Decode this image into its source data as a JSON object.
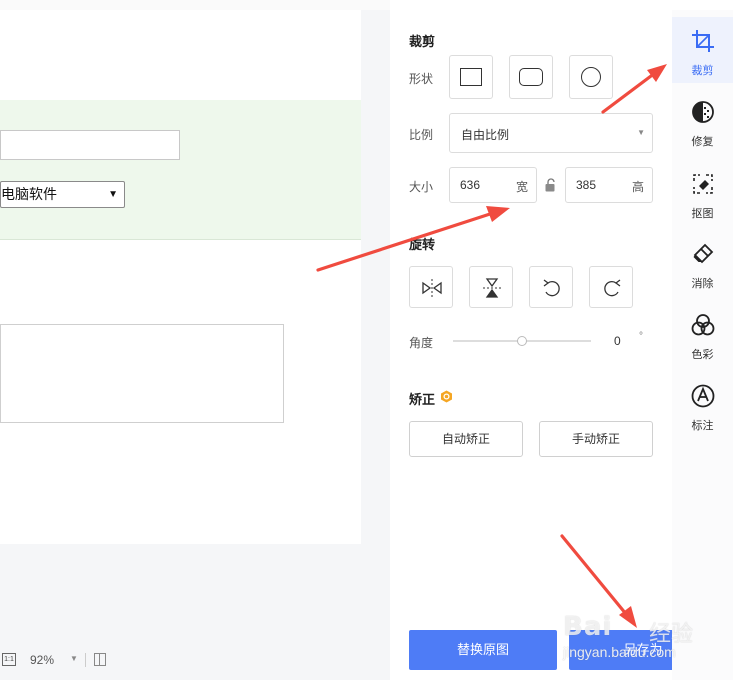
{
  "canvas": {
    "select_value": "电脑软件",
    "zoom_level": "92%",
    "one_to_one_label": "1:1"
  },
  "crop": {
    "section_title": "裁剪",
    "shape_label": "形状",
    "shapes": [
      "square-shape-icon",
      "rounded-rect-shape-icon",
      "circle-shape-icon"
    ],
    "ratio_label": "比例",
    "ratio_value": "自由比例",
    "size_label": "大小",
    "width_value": "636",
    "width_unit": "宽",
    "height_value": "385",
    "height_unit": "高"
  },
  "rotate": {
    "section_title": "旋转",
    "buttons": [
      "flip-horizontal-icon",
      "flip-vertical-icon",
      "rotate-left-icon",
      "rotate-right-icon"
    ],
    "angle_label": "角度",
    "angle_value": "0",
    "angle_unit": "°",
    "angle_slider_fraction": 0.5
  },
  "correct": {
    "section_title": "矫正",
    "auto_label": "自动矫正",
    "manual_label": "手动矫正"
  },
  "actions": {
    "replace_label": "替换原图",
    "save_as_label": "另存为"
  },
  "tools": [
    {
      "label": "裁剪",
      "icon": "crop-icon",
      "active": true
    },
    {
      "label": "修复",
      "icon": "repair-icon",
      "active": false
    },
    {
      "label": "抠图",
      "icon": "cutout-icon",
      "active": false
    },
    {
      "label": "消除",
      "icon": "eraser-icon",
      "active": false
    },
    {
      "label": "色彩",
      "icon": "color-icon",
      "active": false
    },
    {
      "label": "标注",
      "icon": "annotate-icon",
      "active": false
    }
  ],
  "colors": {
    "accent": "#4e7cf6",
    "active_tool": "#3a6cf4",
    "arrow": "#f04b3f",
    "vip_badge": "#f5a623"
  },
  "watermark": {
    "brand": "Bai",
    "brand_suffix": "经验",
    "url": "jingyan.baidu.com"
  }
}
